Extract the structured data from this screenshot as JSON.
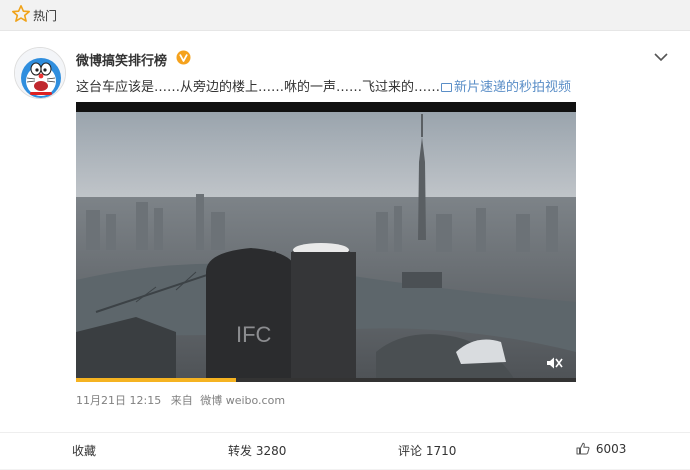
{
  "topbar": {
    "title": "热门",
    "icon": "star-outline-icon"
  },
  "post": {
    "username": "微博搞笑排行榜",
    "verified_badge": "v-verified-badge",
    "text": "这台车应该是……从旁边的楼上……咻的一声……飞过来的……",
    "link_text": "新片速递的秒拍视频",
    "timestamp": "11月21日 12:15",
    "source_prefix": "来自",
    "source": "微博 weibo.com"
  },
  "video": {
    "progress": 0.32,
    "building_label": "IFC",
    "accent_color": "#f5b321"
  },
  "actions": {
    "favorite": "收藏",
    "repost_label": "转发",
    "repost_count": "3280",
    "comment_label": "评论",
    "comment_count": "1710",
    "like_count": "6003"
  },
  "colors": {
    "link": "#5a8ec7",
    "meta": "#808080",
    "accent": "#f5b321"
  }
}
